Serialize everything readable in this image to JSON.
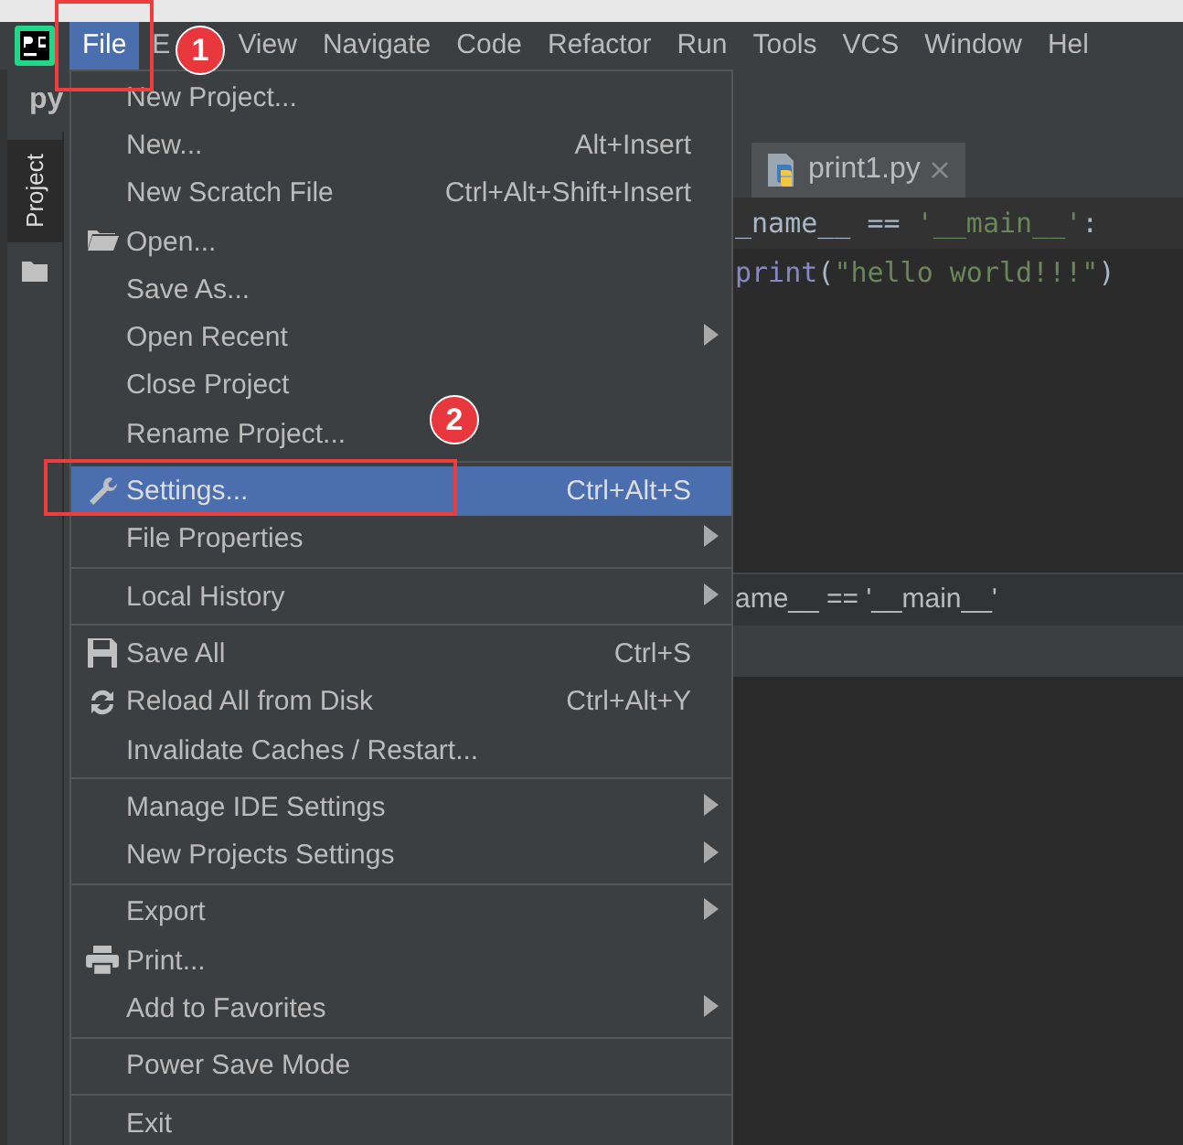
{
  "menubar": [
    {
      "label": "File",
      "selected": true
    },
    {
      "label": "E",
      "selected": false
    },
    {
      "label": "View",
      "selected": false
    },
    {
      "label": "Navigate",
      "selected": false
    },
    {
      "label": "Code",
      "selected": false
    },
    {
      "label": "Refactor",
      "selected": false
    },
    {
      "label": "Run",
      "selected": false
    },
    {
      "label": "Tools",
      "selected": false
    },
    {
      "label": "VCS",
      "selected": false
    },
    {
      "label": "Window",
      "selected": false
    },
    {
      "label": "Hel",
      "selected": false
    }
  ],
  "project_panel": {
    "title": "py"
  },
  "tool_strip": {
    "label": "Project"
  },
  "editor": {
    "tabs": [
      {
        "label": "print1.py",
        "selected": true
      }
    ],
    "code_lines": [
      [
        {
          "text": "_name__",
          "kind": "name"
        },
        {
          "text": " == ",
          "kind": "op"
        },
        {
          "text": "'__main__'",
          "kind": "string"
        },
        {
          "text": ":",
          "kind": "op"
        }
      ],
      [
        {
          "text": "print",
          "kind": "builtin"
        },
        {
          "text": "(",
          "kind": "op"
        },
        {
          "text": "\"hello world!!!\"",
          "kind": "string"
        },
        {
          "text": ")",
          "kind": "op"
        }
      ]
    ],
    "breadcrumb": "ame__ == '__main__'"
  },
  "file_menu": {
    "groups": [
      [
        {
          "label": "New Project...",
          "selected": false
        },
        {
          "label": "New...",
          "shortcut": "Alt+Insert",
          "selected": false
        },
        {
          "label": "New Scratch File",
          "shortcut": "Ctrl+Alt+Shift+Insert",
          "selected": false
        },
        {
          "label": "Open...",
          "kind": "folder",
          "selected": false
        },
        {
          "label": "Save As...",
          "selected": false
        },
        {
          "label": "Open Recent",
          "submenu": true,
          "selected": false
        },
        {
          "label": "Close Project",
          "selected": false
        },
        {
          "label": "Rename Project...",
          "selected": false
        }
      ],
      [
        {
          "label": "Settings...",
          "kind": "wrench",
          "shortcut": "Ctrl+Alt+S",
          "selected": true
        },
        {
          "label": "File Properties",
          "submenu": true,
          "selected": false
        }
      ],
      [
        {
          "label": "Local History",
          "submenu": true,
          "selected": false
        }
      ],
      [
        {
          "label": "Save All",
          "kind": "floppy",
          "shortcut": "Ctrl+S",
          "selected": false
        },
        {
          "label": "Reload All from Disk",
          "kind": "reload",
          "shortcut": "Ctrl+Alt+Y",
          "selected": false
        },
        {
          "label": "Invalidate Caches / Restart...",
          "selected": false
        }
      ],
      [
        {
          "label": "Manage IDE Settings",
          "submenu": true,
          "selected": false
        },
        {
          "label": "New Projects Settings",
          "submenu": true,
          "selected": false
        }
      ],
      [
        {
          "label": "Export",
          "submenu": true,
          "selected": false
        },
        {
          "label": "Print...",
          "kind": "printer",
          "selected": false
        },
        {
          "label": "Add to Favorites",
          "submenu": true,
          "selected": false
        }
      ],
      [
        {
          "label": "Power Save Mode",
          "selected": false
        }
      ],
      [
        {
          "label": "Exit",
          "selected": false
        }
      ]
    ]
  },
  "annotations": [
    {
      "label": "1"
    },
    {
      "label": "2"
    }
  ]
}
